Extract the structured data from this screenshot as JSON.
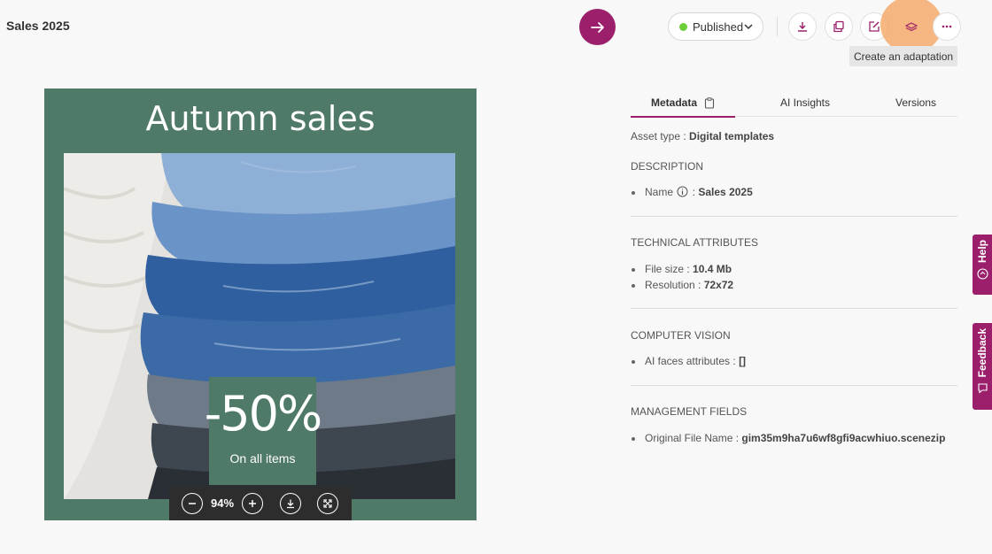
{
  "header": {
    "title": "Sales 2025",
    "status_label": "Published",
    "tooltip": "Create an adaptation"
  },
  "colors": {
    "brand": "#9b1f6b",
    "status_published": "#6ccf3a",
    "template_green": "#4f7a68",
    "highlight": "#f5a05a"
  },
  "preview": {
    "title": "Autumn sales",
    "promo_big": "-50%",
    "promo_sub": "On all items",
    "zoom_level": "94%"
  },
  "tabs": [
    {
      "label": "Metadata"
    },
    {
      "label": "AI Insights"
    },
    {
      "label": "Versions"
    }
  ],
  "metadata": {
    "asset_type_label": "Asset type :",
    "asset_type_value": "Digital templates",
    "description": {
      "heading": "DESCRIPTION",
      "name_label": "Name",
      "name_value": "Sales 2025"
    },
    "technical": {
      "heading": "TECHNICAL ATTRIBUTES",
      "file_size_label": "File size :",
      "file_size_value": "10.4 Mb",
      "resolution_label": "Resolution :",
      "resolution_value": "72x72"
    },
    "vision": {
      "heading": "COMPUTER VISION",
      "faces_label": "AI faces attributes :",
      "faces_value": "[]"
    },
    "management": {
      "heading": "MANAGEMENT FIELDS",
      "original_label": "Original File Name :",
      "original_value": "gim35m9ha7u6wf8gfi9acwhiuo.scenezip"
    }
  },
  "side_tabs": {
    "help": "Help",
    "feedback": "Feedback"
  }
}
